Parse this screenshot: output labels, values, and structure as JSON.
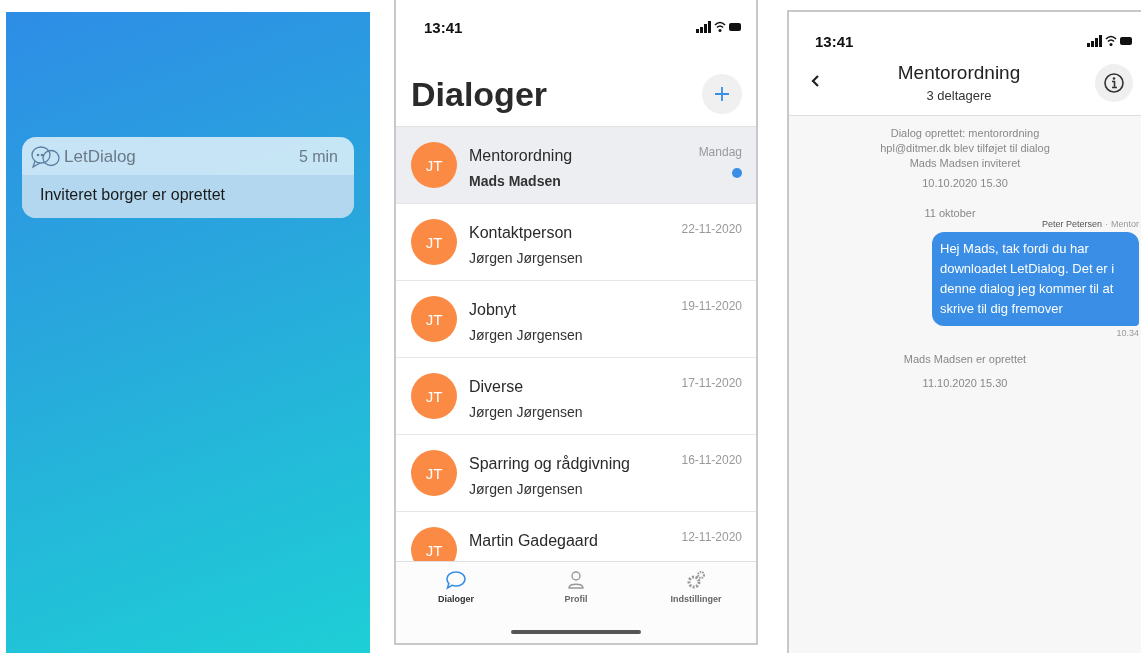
{
  "notification": {
    "app": "LetDialog",
    "time": "5 min",
    "message": "Inviteret borger er oprettet"
  },
  "list_screen": {
    "status_time": "13:41",
    "title": "Dialoger",
    "dialogs": [
      {
        "initials": "JT",
        "title": "Mentorordning",
        "subtitle": "Mads Madsen",
        "date": "Mandag",
        "selected": true,
        "unread": true
      },
      {
        "initials": "JT",
        "title": "Kontaktperson",
        "subtitle": "Jørgen Jørgensen",
        "date": "22-11-2020",
        "selected": false,
        "unread": false
      },
      {
        "initials": "JT",
        "title": "Jobnyt",
        "subtitle": "Jørgen Jørgensen",
        "date": "19-11-2020",
        "selected": false,
        "unread": false
      },
      {
        "initials": "JT",
        "title": "Diverse",
        "subtitle": "Jørgen Jørgensen",
        "date": "17-11-2020",
        "selected": false,
        "unread": false
      },
      {
        "initials": "JT",
        "title": "Sparring og rådgivning",
        "subtitle": "Jørgen Jørgensen",
        "date": "16-11-2020",
        "selected": false,
        "unread": false
      },
      {
        "initials": "JT",
        "title": "Martin Gadegaard",
        "date": "12-11-2020",
        "selected": false,
        "unread": false
      }
    ],
    "tabs": [
      {
        "label": "Dialoger",
        "kind": "chat",
        "selected": true
      },
      {
        "label": "Profil",
        "kind": "person",
        "selected": false
      },
      {
        "label": "Indstillinger",
        "kind": "gears",
        "selected": false
      }
    ]
  },
  "chat_screen": {
    "status_time": "13:41",
    "title": "Mentorordning",
    "subtitle": "3 deltagere",
    "messages": [
      {
        "kind": "system",
        "lines": [
          "Dialog oprettet: mentorordning",
          "hpl@ditmer.dk blev tilføjet til dialog",
          "Mads Madsen inviteret"
        ],
        "time": "10.10.2020 15.30"
      },
      {
        "kind": "date",
        "text": "11 oktober"
      },
      {
        "kind": "bubble",
        "sender": "Peter Petersen",
        "separator": "·",
        "role": "Mentor",
        "text": "Hej Mads, tak fordi du har downloadet LetDialog. Det er i denne dialog jeg kommer til at skrive til dig fremover",
        "time": "10.34"
      },
      {
        "kind": "system",
        "lines": [
          "Mads Madsen er oprettet"
        ],
        "time": "11.10.2020 15.30"
      }
    ]
  }
}
